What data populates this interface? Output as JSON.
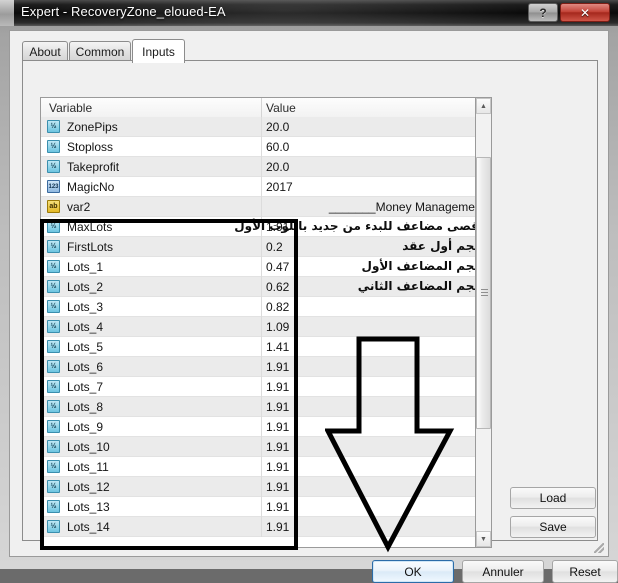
{
  "window": {
    "title": "Expert - RecoveryZone_eloued-EA",
    "help_button": "?",
    "close_button": "✕"
  },
  "tabs": [
    {
      "label": "About",
      "active": false
    },
    {
      "label": "Common",
      "active": false
    },
    {
      "label": "Inputs",
      "active": true
    }
  ],
  "grid": {
    "headers": {
      "variable": "Variable",
      "value": "Value"
    },
    "rows": [
      {
        "icon": "double-icon",
        "icon_glyph": "½",
        "icon_type": "double",
        "name": "ZonePips",
        "value": "20.0",
        "note": ""
      },
      {
        "icon": "double-icon",
        "icon_glyph": "½",
        "icon_type": "double",
        "name": "Stoploss",
        "value": "60.0",
        "note": ""
      },
      {
        "icon": "double-icon",
        "icon_glyph": "½",
        "icon_type": "double",
        "name": "Takeprofit",
        "value": "20.0",
        "note": ""
      },
      {
        "icon": "int-icon",
        "icon_glyph": "123",
        "icon_type": "int",
        "name": "MagicNo",
        "value": "2017",
        "note": ""
      },
      {
        "icon": "string-icon",
        "icon_glyph": "ab",
        "icon_type": "string",
        "name": "var2",
        "value": "_______Money Management",
        "note": "",
        "is_group": true
      },
      {
        "icon": "double-icon",
        "icon_glyph": "½",
        "icon_type": "double",
        "name": "MaxLots",
        "value": "1.91",
        "note": "أقصى مضاعف للبدء من جديد باللوت الأول"
      },
      {
        "icon": "double-icon",
        "icon_glyph": "½",
        "icon_type": "double",
        "name": "FirstLots",
        "value": "0.2",
        "note": "حجم أول عقد"
      },
      {
        "icon": "double-icon",
        "icon_glyph": "½",
        "icon_type": "double",
        "name": "Lots_1",
        "value": "0.47",
        "note": "حجم المضاعف الأول"
      },
      {
        "icon": "double-icon",
        "icon_glyph": "½",
        "icon_type": "double",
        "name": "Lots_2",
        "value": "0.62",
        "note": "حجم المضاعف الثاني"
      },
      {
        "icon": "double-icon",
        "icon_glyph": "½",
        "icon_type": "double",
        "name": "Lots_3",
        "value": "0.82",
        "note": ""
      },
      {
        "icon": "double-icon",
        "icon_glyph": "½",
        "icon_type": "double",
        "name": "Lots_4",
        "value": "1.09",
        "note": ""
      },
      {
        "icon": "double-icon",
        "icon_glyph": "½",
        "icon_type": "double",
        "name": "Lots_5",
        "value": "1.41",
        "note": ""
      },
      {
        "icon": "double-icon",
        "icon_glyph": "½",
        "icon_type": "double",
        "name": "Lots_6",
        "value": "1.91",
        "note": ""
      },
      {
        "icon": "double-icon",
        "icon_glyph": "½",
        "icon_type": "double",
        "name": "Lots_7",
        "value": "1.91",
        "note": ""
      },
      {
        "icon": "double-icon",
        "icon_glyph": "½",
        "icon_type": "double",
        "name": "Lots_8",
        "value": "1.91",
        "note": ""
      },
      {
        "icon": "double-icon",
        "icon_glyph": "½",
        "icon_type": "double",
        "name": "Lots_9",
        "value": "1.91",
        "note": ""
      },
      {
        "icon": "double-icon",
        "icon_glyph": "½",
        "icon_type": "double",
        "name": "Lots_10",
        "value": "1.91",
        "note": ""
      },
      {
        "icon": "double-icon",
        "icon_glyph": "½",
        "icon_type": "double",
        "name": "Lots_11",
        "value": "1.91",
        "note": ""
      },
      {
        "icon": "double-icon",
        "icon_glyph": "½",
        "icon_type": "double",
        "name": "Lots_12",
        "value": "1.91",
        "note": ""
      },
      {
        "icon": "double-icon",
        "icon_glyph": "½",
        "icon_type": "double",
        "name": "Lots_13",
        "value": "1.91",
        "note": ""
      },
      {
        "icon": "double-icon",
        "icon_glyph": "½",
        "icon_type": "double",
        "name": "Lots_14",
        "value": "1.91",
        "note": ""
      }
    ]
  },
  "scrollbar": {
    "up_arrow": "▲",
    "down_arrow": "▼"
  },
  "side_buttons": {
    "load": "Load",
    "save": "Save"
  },
  "bottom_buttons": {
    "ok": "OK",
    "cancel": "Annuler",
    "reset": "Reset"
  },
  "annotations": {
    "highlight_rect_color": "#000000",
    "arrow_color": "#000000"
  }
}
